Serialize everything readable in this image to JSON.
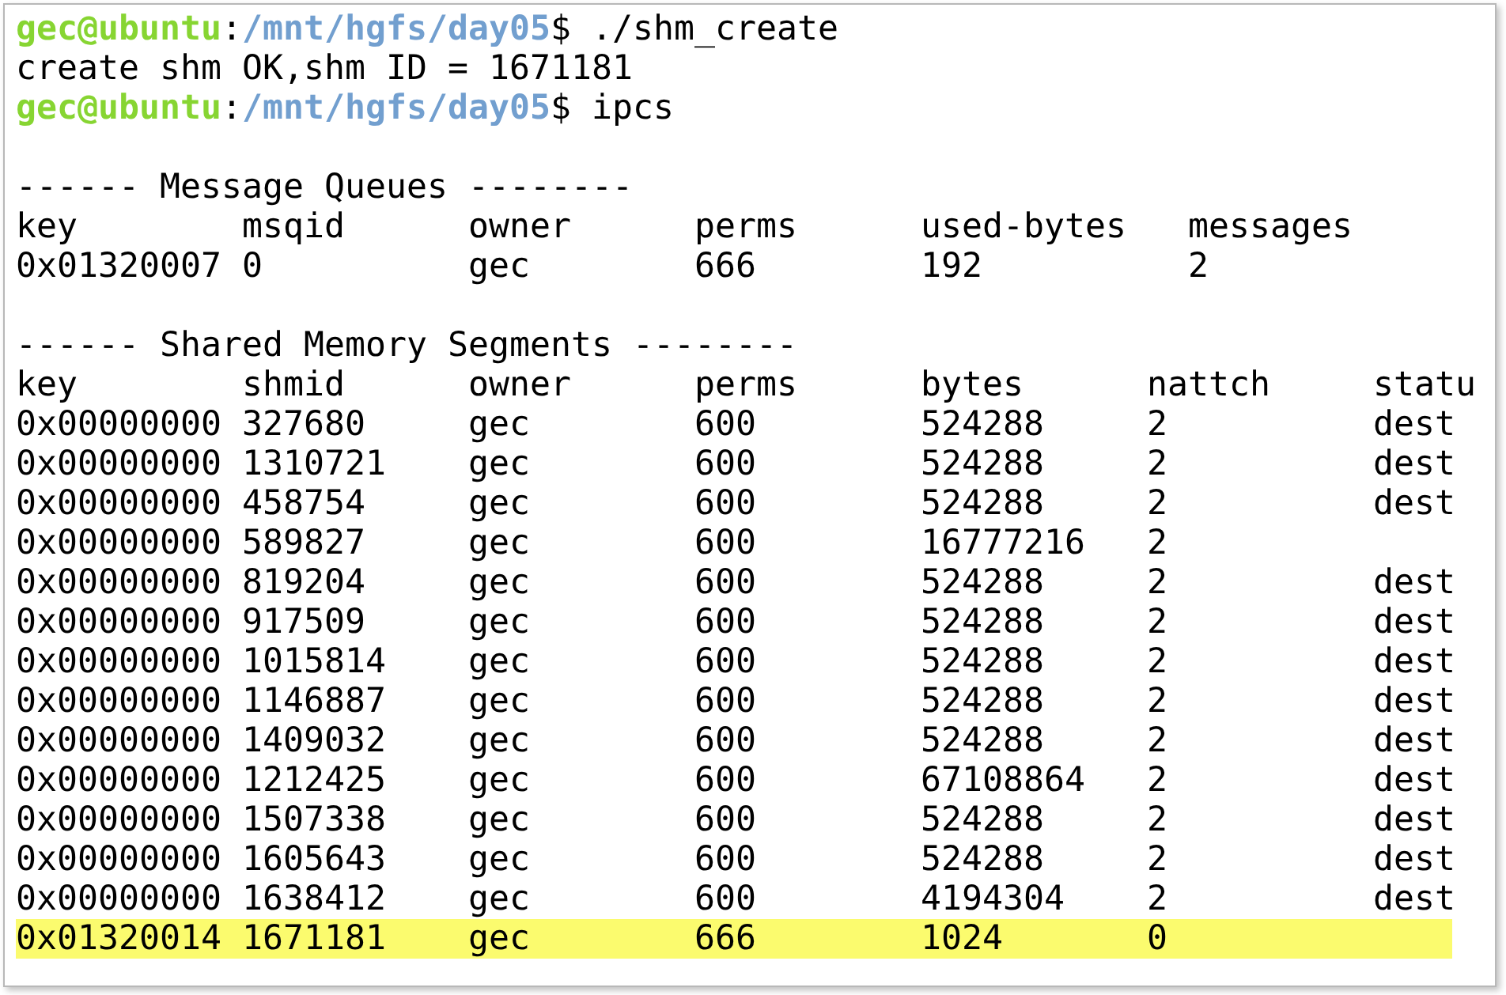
{
  "terminal": {
    "lines": [
      {
        "kind": "prompt",
        "user_host": "gec@ubuntu",
        "separator": ":",
        "path": "/mnt/hgfs/day05",
        "command": "$ ./shm_create"
      },
      {
        "kind": "output",
        "text": "create shm OK,shm ID = 1671181"
      },
      {
        "kind": "prompt",
        "user_host": "gec@ubuntu",
        "separator": ":",
        "path": "/mnt/hgfs/day05",
        "command": "$ ipcs"
      }
    ],
    "message_queues": {
      "heading": "------ Message Queues --------",
      "columns": [
        "key",
        "msqid",
        "owner",
        "perms",
        "used-bytes",
        "messages"
      ],
      "rows": [
        {
          "cells": [
            "0x01320007",
            "0",
            "gec",
            "666",
            "192",
            "2"
          ],
          "highlighted": false
        }
      ]
    },
    "shared_memory": {
      "heading": "------ Shared Memory Segments --------",
      "columns": [
        "key",
        "shmid",
        "owner",
        "perms",
        "bytes",
        "nattch",
        "statu"
      ],
      "rows": [
        {
          "cells": [
            "0x00000000",
            "327680",
            "gec",
            "600",
            "524288",
            "2",
            "dest"
          ],
          "highlighted": false
        },
        {
          "cells": [
            "0x00000000",
            "1310721",
            "gec",
            "600",
            "524288",
            "2",
            "dest"
          ],
          "highlighted": false
        },
        {
          "cells": [
            "0x00000000",
            "458754",
            "gec",
            "600",
            "524288",
            "2",
            "dest"
          ],
          "highlighted": false
        },
        {
          "cells": [
            "0x00000000",
            "589827",
            "gec",
            "600",
            "16777216",
            "2"
          ],
          "highlighted": false
        },
        {
          "cells": [
            "0x00000000",
            "819204",
            "gec",
            "600",
            "524288",
            "2",
            "dest"
          ],
          "highlighted": false
        },
        {
          "cells": [
            "0x00000000",
            "917509",
            "gec",
            "600",
            "524288",
            "2",
            "dest"
          ],
          "highlighted": false
        },
        {
          "cells": [
            "0x00000000",
            "1015814",
            "gec",
            "600",
            "524288",
            "2",
            "dest"
          ],
          "highlighted": false
        },
        {
          "cells": [
            "0x00000000",
            "1146887",
            "gec",
            "600",
            "524288",
            "2",
            "dest"
          ],
          "highlighted": false
        },
        {
          "cells": [
            "0x00000000",
            "1409032",
            "gec",
            "600",
            "524288",
            "2",
            "dest"
          ],
          "highlighted": false
        },
        {
          "cells": [
            "0x00000000",
            "1212425",
            "gec",
            "600",
            "67108864",
            "2",
            "dest"
          ],
          "highlighted": false
        },
        {
          "cells": [
            "0x00000000",
            "1507338",
            "gec",
            "600",
            "524288",
            "2",
            "dest"
          ],
          "highlighted": false
        },
        {
          "cells": [
            "0x00000000",
            "1605643",
            "gec",
            "600",
            "524288",
            "2",
            "dest"
          ],
          "highlighted": false
        },
        {
          "cells": [
            "0x00000000",
            "1638412",
            "gec",
            "600",
            "4194304",
            "2",
            "dest"
          ],
          "highlighted": false
        },
        {
          "cells": [
            "0x01320014",
            "1671181",
            "gec",
            "666",
            "1024",
            "0"
          ],
          "highlighted": true
        }
      ]
    }
  }
}
